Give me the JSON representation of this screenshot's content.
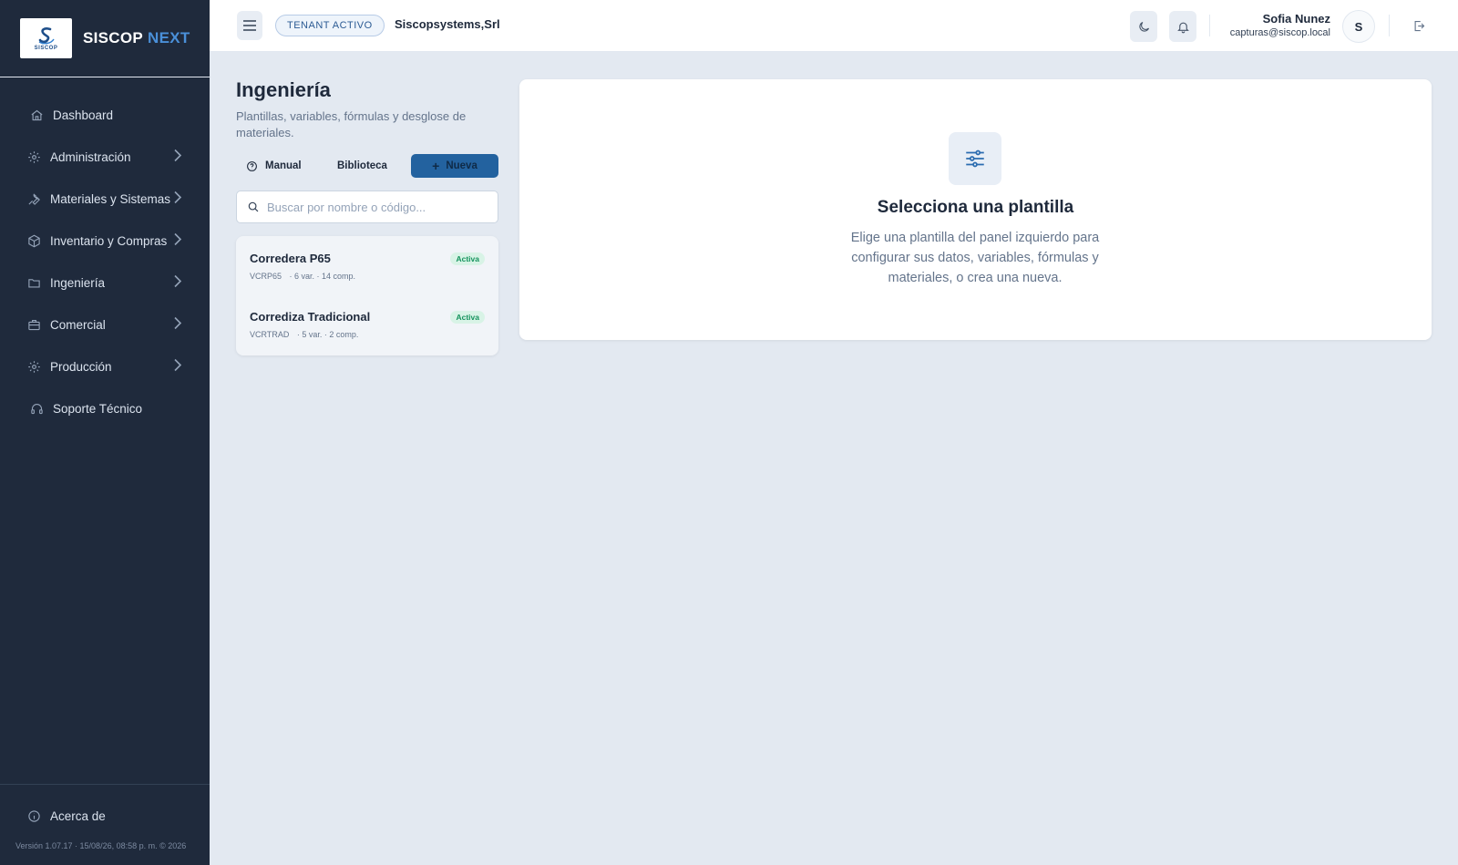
{
  "brand": {
    "logo_text": "SISCOP",
    "name": "SISCOP",
    "accent": "NEXT"
  },
  "sidebar": {
    "items": [
      {
        "label": "Dashboard",
        "icon": "home-icon",
        "has_children": false
      },
      {
        "label": "Administración",
        "icon": "gear-icon",
        "has_children": true
      },
      {
        "label": "Materiales y Sistemas",
        "icon": "wrench-icon",
        "has_children": true
      },
      {
        "label": "Inventario y Compras",
        "icon": "box-icon",
        "has_children": true
      },
      {
        "label": "Ingeniería",
        "icon": "folder-icon",
        "has_children": true
      },
      {
        "label": "Comercial",
        "icon": "briefcase-icon",
        "has_children": true
      },
      {
        "label": "Producción",
        "icon": "gear-icon",
        "has_children": true
      },
      {
        "label": "Soporte Técnico",
        "icon": "headset-icon",
        "has_children": false
      }
    ],
    "about_label": "Acerca de",
    "version": "Versión 1.07.17 · 15/08/26, 08:58 p. m. © 2026"
  },
  "header": {
    "tenant_pill": "TENANT ACTIVO",
    "tenant_name": "Siscopsystems,Srl",
    "user_name": "Sofia Nunez",
    "user_email": "capturas@siscop.local",
    "avatar_initial": "S"
  },
  "page": {
    "title": "Ingeniería",
    "subtitle": "Plantillas, variables, fórmulas y desglose de materiales.",
    "manual_label": "Manual",
    "library_label": "Biblioteca",
    "new_label": "Nueva",
    "search_placeholder": "Buscar por nombre o código..."
  },
  "templates": [
    {
      "name": "Corredera P65",
      "code": "VCRP65",
      "meta": "· 6 var. · 14 comp.",
      "status": "Activa"
    },
    {
      "name": "Corrediza Tradicional",
      "code": "VCRTRAD",
      "meta": "· 5 var. · 2 comp.",
      "status": "Activa"
    }
  ],
  "empty_state": {
    "title": "Selecciona una plantilla",
    "description": "Elige una plantilla del panel izquierdo para configurar sus datos, variables, fórmulas y materiales, o crea una nueva."
  },
  "colors": {
    "sidebar_bg": "#1f2a3c",
    "accent": "#4a90d9",
    "primary_button": "#23629f",
    "badge_bg": "#d8f3e6",
    "badge_text": "#15935d"
  }
}
